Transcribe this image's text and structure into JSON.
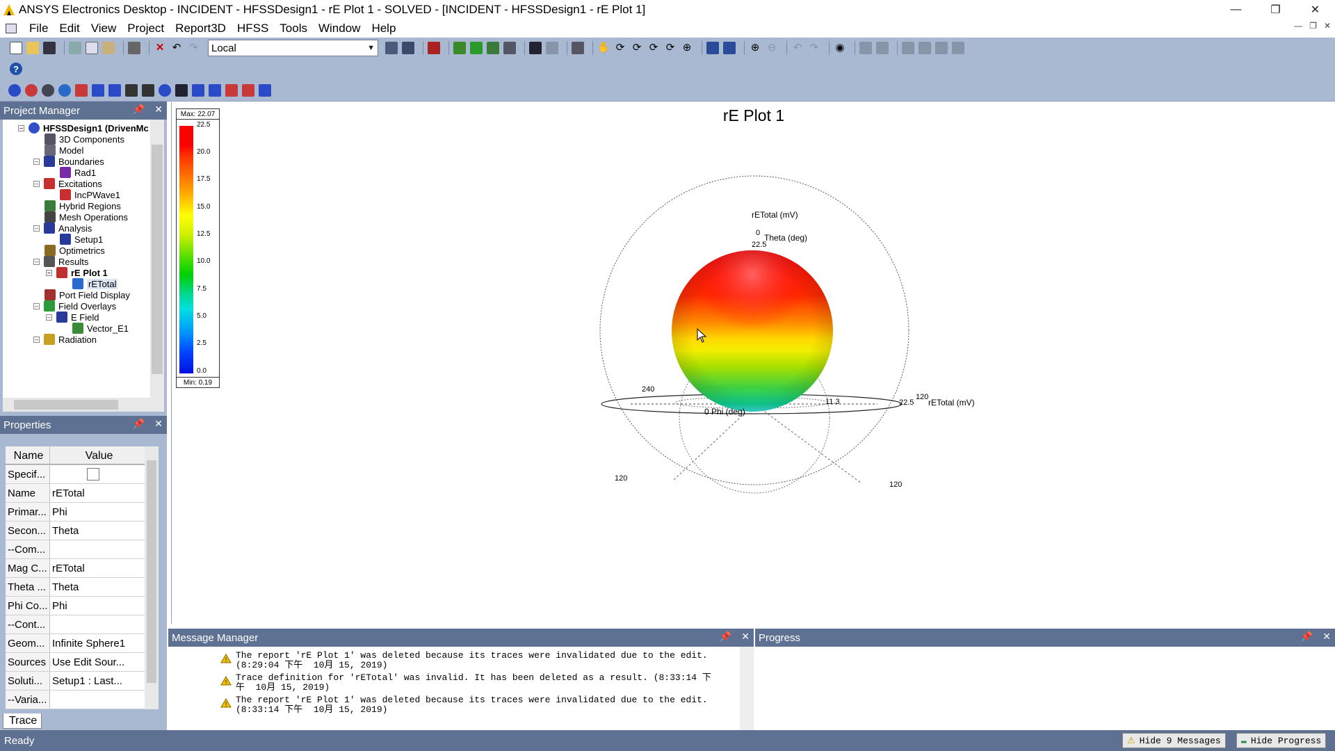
{
  "window": {
    "title": "ANSYS Electronics Desktop - INCIDENT - HFSSDesign1 - rE Plot 1 - SOLVED - [INCIDENT - HFSSDesign1 - rE Plot 1]"
  },
  "menu": [
    "File",
    "Edit",
    "View",
    "Project",
    "Report3D",
    "HFSS",
    "Tools",
    "Window",
    "Help"
  ],
  "toolbar": {
    "coord_system": "Local"
  },
  "project_manager": {
    "title": "Project Manager",
    "items": [
      {
        "label": "HFSSDesign1 (DrivenMc",
        "color": "#3450c8"
      },
      {
        "label": "3D Components",
        "color": "#556"
      },
      {
        "label": "Model",
        "color": "#556"
      },
      {
        "label": "Boundaries",
        "color": "#2a3a9a"
      },
      {
        "label": "Rad1",
        "color": "#7a2aa8"
      },
      {
        "label": "Excitations",
        "color": "#c83030"
      },
      {
        "label": "IncPWave1",
        "color": "#c83030"
      },
      {
        "label": "Hybrid Regions",
        "color": "#3a7a3a"
      },
      {
        "label": "Mesh Operations",
        "color": "#444"
      },
      {
        "label": "Analysis",
        "color": "#2a3a9a"
      },
      {
        "label": "Setup1",
        "color": "#2a3a9a"
      },
      {
        "label": "Optimetrics",
        "color": "#8a6a20"
      },
      {
        "label": "Results",
        "color": "#555"
      },
      {
        "label": "rE Plot 1",
        "color": "#c03030"
      },
      {
        "label": "rETotal",
        "color": "#2a6ad0"
      },
      {
        "label": "Port Field Display",
        "color": "#a03030"
      },
      {
        "label": "Field Overlays",
        "color": "#2a9a3a"
      },
      {
        "label": "E Field",
        "color": "#2a3a9a"
      },
      {
        "label": "Vector_E1",
        "color": "#3a8a3a"
      },
      {
        "label": "Radiation",
        "color": "#c8a020"
      }
    ]
  },
  "properties": {
    "title": "Properties",
    "col_name": "Name",
    "col_value": "Value",
    "rows": [
      {
        "name": "Specif...",
        "value": ""
      },
      {
        "name": "Name",
        "value": "rETotal"
      },
      {
        "name": "Primar...",
        "value": "Phi"
      },
      {
        "name": "Secon...",
        "value": "Theta"
      },
      {
        "name": "--Com...",
        "value": ""
      },
      {
        "name": "Mag C...",
        "value": "rETotal"
      },
      {
        "name": "Theta ...",
        "value": "Theta"
      },
      {
        "name": "Phi Co...",
        "value": "Phi"
      },
      {
        "name": "--Cont...",
        "value": ""
      },
      {
        "name": "Geom...",
        "value": "Infinite Sphere1"
      },
      {
        "name": "Sources",
        "value": "Use Edit Sour..."
      },
      {
        "name": "Soluti...",
        "value": "Setup1 : Last..."
      },
      {
        "name": "--Varia...",
        "value": ""
      }
    ],
    "tab": "Trace"
  },
  "plot": {
    "title": "rE Plot 1",
    "legend_max": "Max: 22.07",
    "legend_min": "Min: 0.19",
    "legend_ticks": [
      "22.5",
      "20.0",
      "17.5",
      "15.0",
      "12.5",
      "10.0",
      "7.5",
      "5.0",
      "2.5",
      "0.0"
    ],
    "labels": {
      "z_axis": "rETotal (mV)",
      "theta": "Theta (deg)",
      "zero_top": "0",
      "val_top": "22.5",
      "phi": "0  Phi (deg)",
      "l240": "240",
      "l113": "11.3",
      "l120a": "120",
      "x_axis": "rETotal (mV)",
      "l225r": "22.5",
      "l120b": "120",
      "l120c": "120"
    }
  },
  "messages": {
    "title": "Message Manager",
    "items": [
      {
        "l1": "The report 'rE Plot 1' was deleted because its traces were invalidated due to the edit.",
        "l2": "(8:29:04 下午  10月 15, 2019)"
      },
      {
        "l1": "Trace definition for 'rETotal' was invalid. It has been deleted as a result. (8:33:14 下",
        "l2": "午  10月 15, 2019)"
      },
      {
        "l1": "The report 'rE Plot 1' was deleted because its traces were invalidated due to the edit.",
        "l2": "(8:33:14 下午  10月 15, 2019)"
      }
    ]
  },
  "progress": {
    "title": "Progress"
  },
  "status": {
    "text": "Ready",
    "hide_messages": "Hide 9 Messages",
    "hide_progress": "Hide Progress"
  }
}
